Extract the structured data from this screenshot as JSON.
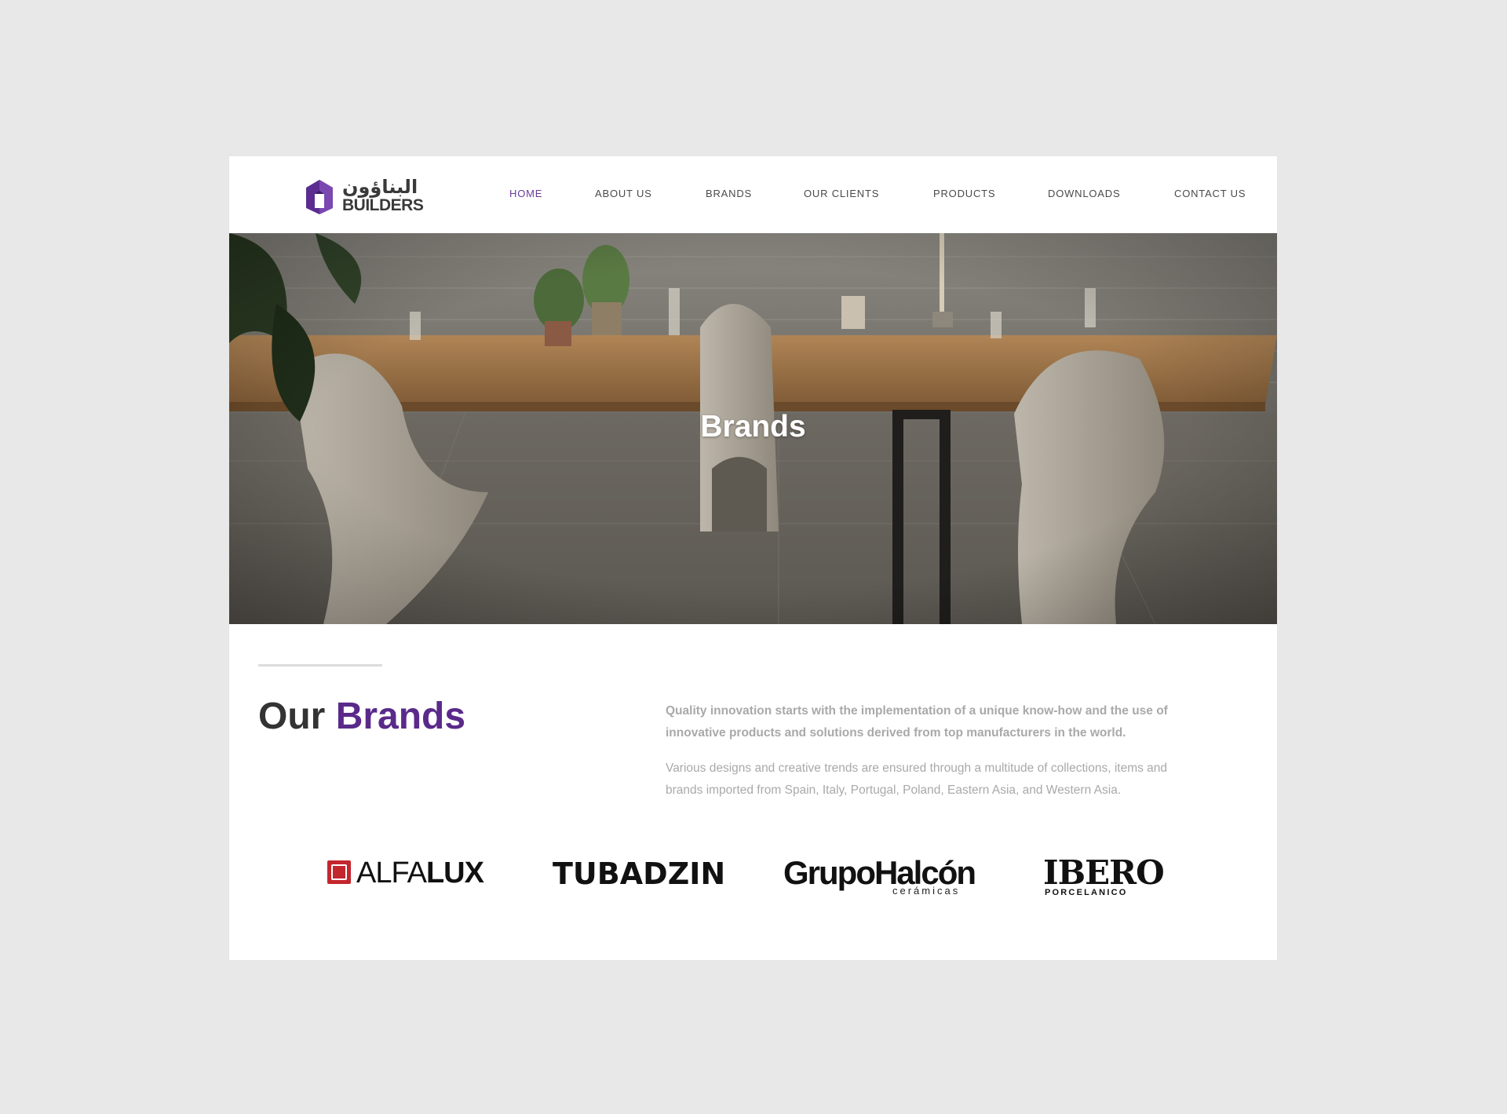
{
  "brand": {
    "arabic_name": "البناؤون",
    "latin_name": "BUILDERS",
    "colors": {
      "accent": "#5a2a8a",
      "nav_active": "#6a3a9a",
      "text_dark": "#333333",
      "text_muted": "#a9a9a9",
      "page_bg": "#e8e8e8"
    }
  },
  "nav": {
    "items": [
      {
        "label": "HOME",
        "active": true
      },
      {
        "label": "ABOUT US"
      },
      {
        "label": "BRANDS"
      },
      {
        "label": "OUR CLIENTS"
      },
      {
        "label": "PRODUCTS"
      },
      {
        "label": "DOWNLOADS"
      },
      {
        "label": "CONTACT US"
      }
    ]
  },
  "hero": {
    "title": "Brands"
  },
  "section": {
    "heading_prefix": "Our",
    "heading_accent": "Brands",
    "intro_strong": "Quality innovation starts with the implementation of a unique know-how and the use of innovative products and solutions derived from top manufacturers in the world.",
    "intro_normal": "Various designs and creative trends are ensured through a multitude of collections, items and brands imported from Spain, Italy, Portugal, Poland, Eastern Asia, and Western Asia."
  },
  "brands": {
    "alfalux": {
      "part1": "ALFA",
      "part2": "LUX"
    },
    "tubadzin": {
      "name": "TUBADZIN"
    },
    "halcon": {
      "name": "GrupoHalcón",
      "sub": "cerámicas"
    },
    "ibero": {
      "name": "IBERO",
      "sub": "PORCELANICO"
    }
  }
}
